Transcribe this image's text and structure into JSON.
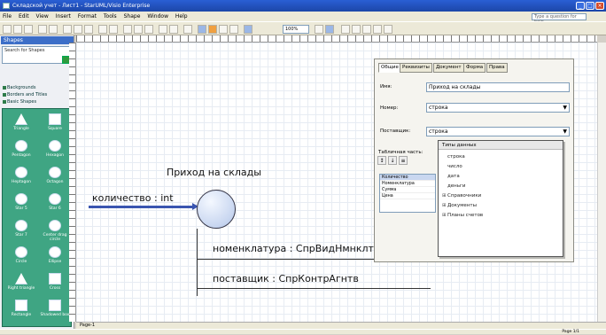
{
  "window": {
    "title": "Складской учет - Лист1 - StarUML/Visio Enterprise"
  },
  "menu": [
    "File",
    "Edit",
    "View",
    "Insert",
    "Format",
    "Tools",
    "Shape",
    "Window",
    "Help"
  ],
  "help_box": "Type a question for help",
  "toolbar": {
    "zoom": "100%"
  },
  "shapes_panel": {
    "title": "Shapes",
    "search_placeholder": "Search for Shapes",
    "stencils": [
      "Backgrounds",
      "Borders and Titles",
      "Basic Shapes"
    ],
    "items": [
      {
        "label": "Triangle",
        "shape": "tri"
      },
      {
        "label": "Square",
        "shape": "rect"
      },
      {
        "label": "Pentagon",
        "shape": "circ"
      },
      {
        "label": "Hexagon",
        "shape": "circ"
      },
      {
        "label": "Heptagon",
        "shape": "circ"
      },
      {
        "label": "Octagon",
        "shape": "circ"
      },
      {
        "label": "Star 5",
        "shape": "circ"
      },
      {
        "label": "Star 6",
        "shape": "circ"
      },
      {
        "label": "Star 7",
        "shape": "circ"
      },
      {
        "label": "Center drag circle",
        "shape": "circ"
      },
      {
        "label": "Circle",
        "shape": "circ"
      },
      {
        "label": "Ellipse",
        "shape": "circ"
      },
      {
        "label": "Right triangle",
        "shape": "tri"
      },
      {
        "label": "Cross",
        "shape": "rect"
      },
      {
        "label": "Rectangle",
        "shape": "rect"
      },
      {
        "label": "Shadowed box",
        "shape": "rect"
      }
    ]
  },
  "page_tab": "Page-1",
  "status": "Page 1/1",
  "diagram": {
    "title": "Приход на склады",
    "attr_in": "количество : int",
    "attr_1": "номенклатура : СпрВидНмнклтр",
    "attr_2": "поставщик : СпрКонтрАгнтв"
  },
  "dialog": {
    "tabs": [
      "Общие",
      "Реквизиты",
      "Документ",
      "Форма",
      "Права"
    ],
    "name_label": "Имя:",
    "name_value": "Приход на склады",
    "num_label": "Номер:",
    "num_value": "строка",
    "sup_label": "Поставщик:",
    "sup_value": "строка",
    "table_label": "Табличная часть:",
    "table_rows": [
      "Количество",
      "Номенклатура",
      "Сумма",
      "Цена"
    ],
    "dropdown": {
      "header": "Типы данных",
      "items": [
        {
          "text": "строка",
          "expand": ""
        },
        {
          "text": "число",
          "expand": ""
        },
        {
          "text": "дата",
          "expand": ""
        },
        {
          "text": "деньги",
          "expand": ""
        },
        {
          "text": "Справочники",
          "expand": "⊞"
        },
        {
          "text": "Документы",
          "expand": "⊞"
        },
        {
          "text": "Планы счетов",
          "expand": "⊞"
        }
      ]
    }
  }
}
